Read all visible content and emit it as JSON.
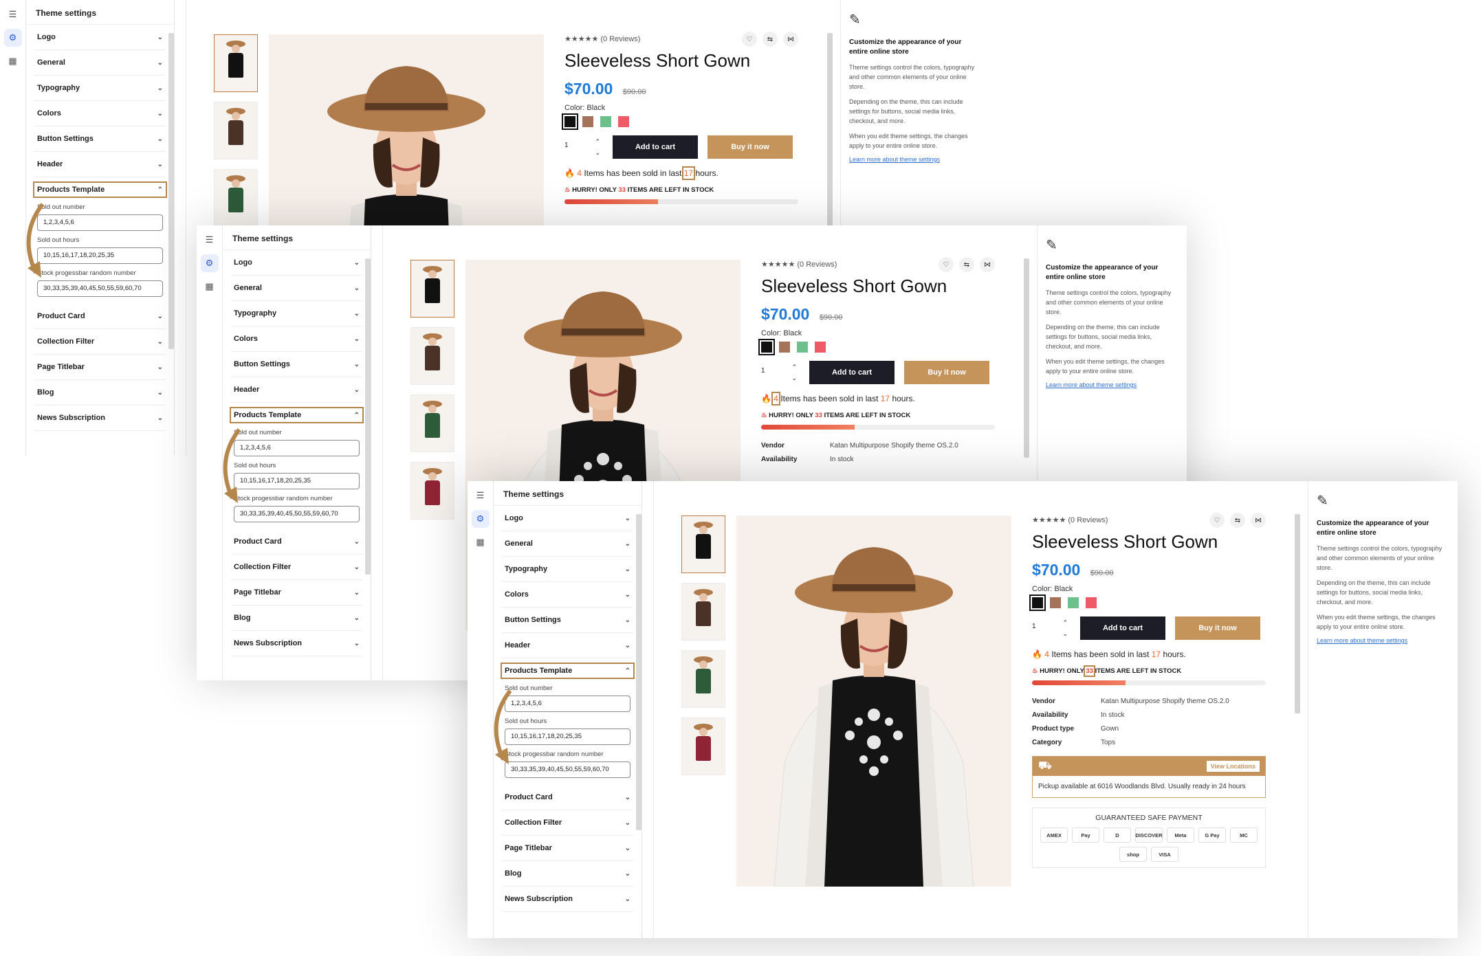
{
  "settings": {
    "title": "Theme settings",
    "sections_top": [
      "Logo",
      "General",
      "Typography",
      "Colors",
      "Button Settings",
      "Header"
    ],
    "active_section": "Products Template",
    "fields": [
      {
        "label": "Sold out number",
        "value": "1,2,3,4,5,6"
      },
      {
        "label": "Sold out hours",
        "value": "10,15,16,17,18,20,25,35"
      },
      {
        "label": "Stock progessbar random number",
        "value": "30,33,35,39,40,45,50,55,59,60,70"
      }
    ],
    "sections_bottom": [
      "Product Card",
      "Collection Filter",
      "Page Titlebar",
      "Blog",
      "News Subscription"
    ]
  },
  "product": {
    "reviews": "★★★★★ (0 Reviews)",
    "title": "Sleeveless Short Gown",
    "price": "$70.00",
    "old_price": "$90.00",
    "color_label": "Color: Black",
    "swatches": [
      "#111111",
      "#a5735a",
      "#6cc08b",
      "#ee5b66"
    ],
    "qty": "1",
    "add_to_cart": "Add to cart",
    "buy_now": "Buy it now",
    "sold_count": "4",
    "sold_text_mid": "Items has been sold in last",
    "sold_hours": "17",
    "sold_text_end": "hours.",
    "hurry_pre": "HURRY! ONLY",
    "hurry_count": "33",
    "hurry_post": "ITEMS ARE LEFT IN STOCK",
    "stock_fill_pct": 40,
    "meta": [
      {
        "key": "Vendor",
        "value": "Katan Multipurpose Shopify theme OS.2.0"
      },
      {
        "key": "Availability",
        "value": "In stock"
      },
      {
        "key": "Product type",
        "value": "Gown"
      },
      {
        "key": "Category",
        "value": "Tops"
      }
    ],
    "view_locations": "View Locations",
    "pickup_text": "Pickup available at 6016 Woodlands Blvd. Usually ready in 24 hours",
    "guaranteed": "GUARANTEED SAFE PAYMENT",
    "payments": [
      "AMEX",
      "Pay",
      "D",
      "DISCOVER",
      "Meta",
      "G Pay",
      "MC",
      "shop",
      "VISA"
    ],
    "thumb_colors": [
      "#111111",
      "#4a3226",
      "#2e5b3a",
      "#8f2434"
    ]
  },
  "help": {
    "title": "Customize the appearance of your entire online store",
    "p1": "Theme settings control the colors, typography and other common elements of your online store.",
    "p2": "Depending on the theme, this can include settings for buttons, social media links, checkout, and more.",
    "p3": "When you edit theme settings, the changes apply to your entire online store.",
    "link": "Learn more about theme settings"
  },
  "colors": {
    "accent": "#b5874d",
    "price": "#1f7ad7",
    "dark": "#1c1d27",
    "gold": "#c5945b"
  }
}
